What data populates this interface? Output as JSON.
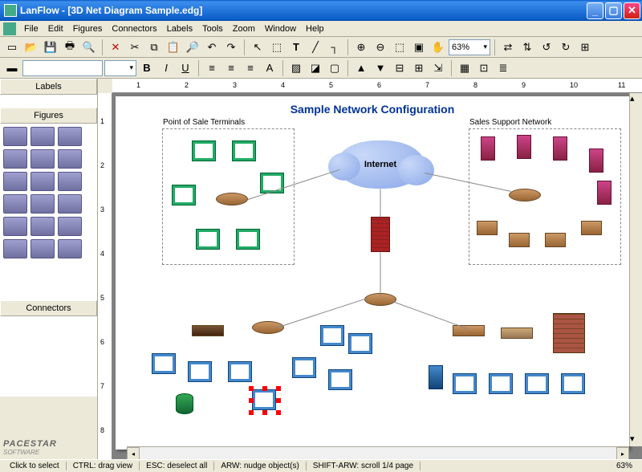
{
  "window": {
    "app_name": "LanFlow",
    "document": "[3D Net Diagram Sample.edg]"
  },
  "menu": [
    "File",
    "Edit",
    "Figures",
    "Connectors",
    "Labels",
    "Tools",
    "Zoom",
    "Window",
    "Help"
  ],
  "toolbar1": {
    "zoom_value": "63%"
  },
  "sidebar": {
    "sections": {
      "labels": "Labels",
      "figures": "Figures",
      "connectors": "Connectors"
    },
    "brand": "PACESTAR",
    "brand_sub": "SOFTWARE"
  },
  "diagram": {
    "title": "Sample Network Configuration",
    "groups": {
      "pos": "Point of Sale Terminals",
      "sales": "Sales Support Network"
    },
    "cloud_label": "Internet"
  },
  "ruler_h": [
    "1",
    "2",
    "3",
    "4",
    "5",
    "6",
    "7",
    "8",
    "9",
    "10",
    "11"
  ],
  "ruler_v": [
    "1",
    "2",
    "3",
    "4",
    "5",
    "6",
    "7",
    "8"
  ],
  "status": {
    "s1": "Click to select",
    "s2": "CTRL: drag view",
    "s3": "ESC: deselect all",
    "s4": "ARW: nudge object(s)",
    "s5": "SHIFT-ARW: scroll 1/4 page",
    "zoom": "63%"
  }
}
